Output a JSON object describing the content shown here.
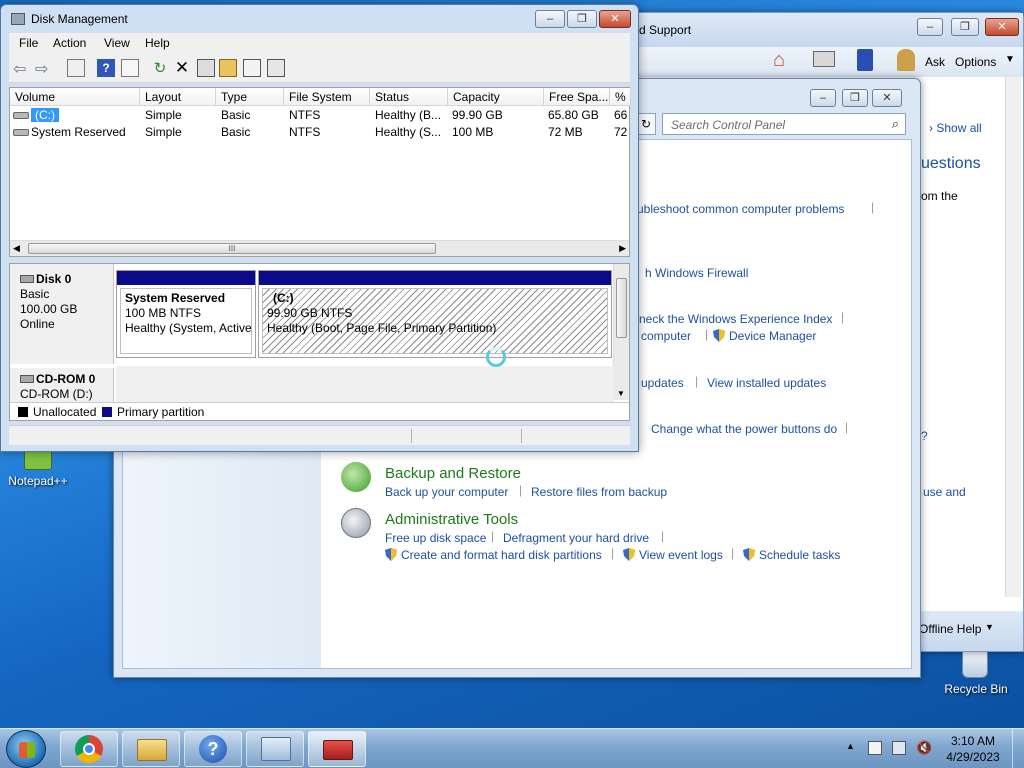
{
  "help_support": {
    "title": "d Support",
    "toolbar": {
      "ask": "Ask",
      "options": "Options"
    },
    "search_placeholder": "",
    "show_all": "Show all",
    "questions": "uestions",
    "from_the": "om the",
    "question_mark": "r?",
    "use_and": "use and",
    "offline_help": "Offline Help"
  },
  "control_panel": {
    "search_placeholder": "Search Control Panel",
    "links": {
      "troubleshoot": "ubleshoot common computer problems",
      "firewall": "h Windows Firewall",
      "experience_index": "neck the Windows Experience Index",
      "computer": "computer",
      "device_manager": "Device Manager",
      "updates": "updates",
      "view_installed_updates": "View installed updates",
      "power_buttons": "Change what the power buttons do"
    },
    "backup": {
      "title": "Backup and Restore",
      "back_up": "Back up your computer",
      "restore": "Restore files from backup"
    },
    "admin_tools": {
      "title": "Administrative Tools",
      "free_up": "Free up disk space",
      "defragment": "Defragment your hard drive",
      "create_format": "Create and format hard disk partitions",
      "event_logs": "View event logs",
      "schedule": "Schedule tasks"
    }
  },
  "disk_management": {
    "title": "Disk Management",
    "menu": [
      "File",
      "Action",
      "View",
      "Help"
    ],
    "columns": [
      "Volume",
      "Layout",
      "Type",
      "File System",
      "Status",
      "Capacity",
      "Free Spa...",
      "% F"
    ],
    "volumes": [
      {
        "volume": "(C:)",
        "layout": "Simple",
        "type": "Basic",
        "fs": "NTFS",
        "status": "Healthy (B...",
        "capacity": "99.90 GB",
        "free": "65.80 GB",
        "pct": "66"
      },
      {
        "volume": "System Reserved",
        "layout": "Simple",
        "type": "Basic",
        "fs": "NTFS",
        "status": "Healthy (S...",
        "capacity": "100 MB",
        "free": "72 MB",
        "pct": "72"
      }
    ],
    "scroll_grip": "III",
    "disk0": {
      "name": "Disk 0",
      "type": "Basic",
      "size": "100.00 GB",
      "state": "Online",
      "part1": {
        "name": "System Reserved",
        "size": "100 MB NTFS",
        "status": "Healthy (System, Active,"
      },
      "part2": {
        "name": "(C:)",
        "size": "99.90 GB NTFS",
        "status": "Healthy (Boot, Page File, Primary Partition)"
      }
    },
    "cdrom": {
      "name": "CD-ROM 0",
      "drive": "CD-ROM (D:)"
    },
    "legend": {
      "unallocated": "Unallocated",
      "primary": "Primary partition"
    }
  },
  "desktop": {
    "notepad": "Notepad++",
    "recycle_bin": "Recycle Bin"
  },
  "taskbar": {
    "time": "3:10 AM",
    "date": "4/29/2023"
  },
  "colors": {
    "primary_partition": "#0a0a8a",
    "category_green": "#1e7a1e",
    "link_blue": "#1e50a2"
  }
}
